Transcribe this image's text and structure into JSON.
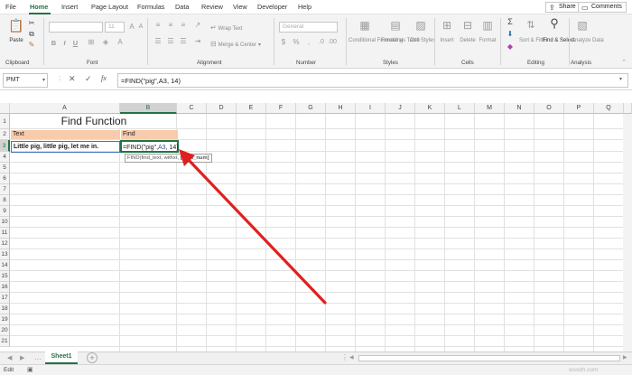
{
  "menu": {
    "tabs": [
      "File",
      "Home",
      "Insert",
      "Page Layout",
      "Formulas",
      "Data",
      "Review",
      "View",
      "Developer",
      "Help"
    ],
    "share": "Share",
    "comments": "Comments"
  },
  "ribbon": {
    "clipboard": {
      "paste": "Paste",
      "label": "Clipboard"
    },
    "font": {
      "size": "11",
      "label": "Font"
    },
    "alignment": {
      "wrap": "Wrap Text",
      "merge": "Merge & Center",
      "label": "Alignment"
    },
    "number": {
      "format": "General",
      "label": "Number"
    },
    "styles": {
      "conditional": "Conditional Formatting",
      "format_table": "Format as Table",
      "cell_styles": "Cell Styles",
      "label": "Styles"
    },
    "cells": {
      "insert": "Insert",
      "delete": "Delete",
      "format": "Format",
      "label": "Cells"
    },
    "editing": {
      "sort": "Sort & Filter",
      "find": "Find & Select",
      "label": "Editing"
    },
    "analysis": {
      "analyze": "Analyze Data",
      "label": "Analysis"
    }
  },
  "formula_bar": {
    "name_box": "PMT",
    "fx": "fx",
    "formula": "=FIND(\"pig\",A3, 14)"
  },
  "grid": {
    "columns": [
      "A",
      "B",
      "C",
      "D",
      "E",
      "F",
      "G",
      "H",
      "I",
      "J",
      "K",
      "L",
      "M",
      "N",
      "O",
      "P",
      "Q"
    ],
    "rows": [
      "1",
      "2",
      "3",
      "4",
      "5",
      "6",
      "7",
      "8",
      "9",
      "10",
      "11",
      "12",
      "13",
      "14",
      "15",
      "16",
      "17",
      "18",
      "19",
      "20",
      "21"
    ],
    "title": "Find Function",
    "header_text": "Text",
    "header_find": "Find",
    "a3": "Little pig, little pig, let me in.",
    "b3_prefix": "=FIND(",
    "b3_string": "\"pig\"",
    "b3_comma": ",",
    "b3_ref": "A3",
    "b3_suffix": ", 14)",
    "tooltip_prefix": "FIND(find_text, with",
    "tooltip_mid": "xt, ",
    "tooltip_bold": "[start_num]",
    "header_fill": "#f8cbad",
    "ref_color": "#2f5597",
    "arrow_color": "#e02020"
  },
  "sheet_tabs": {
    "active": "Sheet1"
  },
  "status": {
    "mode": "Edit"
  },
  "watermark": "wsxdn.com"
}
